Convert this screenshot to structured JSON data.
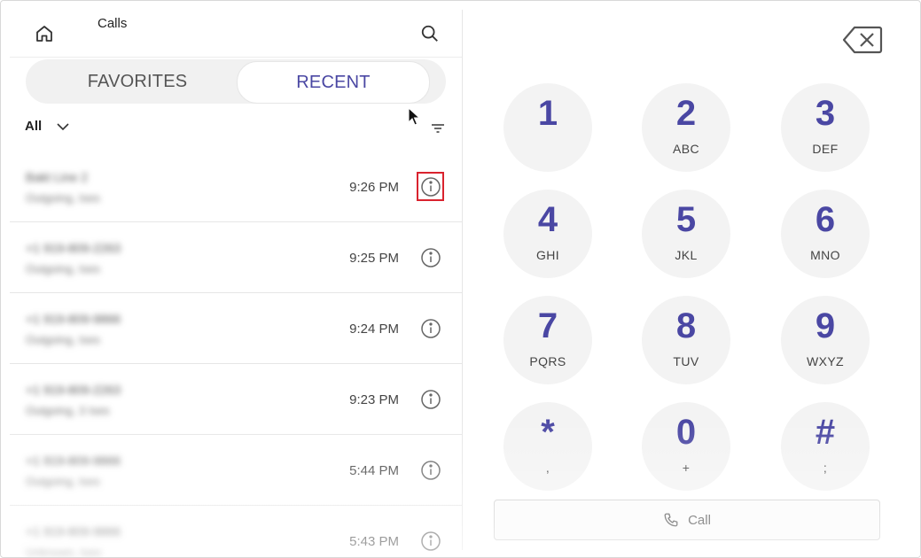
{
  "header": {
    "title": "Calls"
  },
  "tabs": [
    {
      "label": "FAVORITES"
    },
    {
      "label": "RECENT"
    }
  ],
  "filter": {
    "label": "All"
  },
  "calls": [
    {
      "name": "Bakt Line 2",
      "sub": "Outgoing, Ises",
      "time": "9:26 PM"
    },
    {
      "name": "+1 919-809-2263",
      "sub": "Outgoing, Ises",
      "time": "9:25 PM"
    },
    {
      "name": "+1 919-809-9866",
      "sub": "Outgoing, Ises",
      "time": "9:24 PM"
    },
    {
      "name": "+1 919-809-2263",
      "sub": "Outgoing, 3 Ises",
      "time": "9:23 PM"
    },
    {
      "name": "+1 919-809-9866",
      "sub": "Outgoing, Ises",
      "time": "5:44 PM"
    },
    {
      "name": "+1 919-809-9866",
      "sub": "Unknown, Ises",
      "time": "5:43 PM"
    }
  ],
  "dialpad": [
    {
      "digit": "1",
      "letters": ""
    },
    {
      "digit": "2",
      "letters": "ABC"
    },
    {
      "digit": "3",
      "letters": "DEF"
    },
    {
      "digit": "4",
      "letters": "GHI"
    },
    {
      "digit": "5",
      "letters": "JKL"
    },
    {
      "digit": "6",
      "letters": "MNO"
    },
    {
      "digit": "7",
      "letters": "PQRS"
    },
    {
      "digit": "8",
      "letters": "TUV"
    },
    {
      "digit": "9",
      "letters": "WXYZ"
    },
    {
      "digit": "*",
      "letters": ","
    },
    {
      "digit": "0",
      "letters": "+"
    },
    {
      "digit": "#",
      "letters": ";"
    }
  ],
  "call_button": {
    "label": "Call"
  },
  "icons": {
    "home": "home-icon",
    "search": "search-icon",
    "chevron": "chevron-down-icon",
    "sort": "sort-icon",
    "info": "info-icon",
    "backspace": "backspace-icon",
    "phone": "phone-icon"
  },
  "colors": {
    "accent": "#4a47a3",
    "highlight": "#d9232e"
  }
}
